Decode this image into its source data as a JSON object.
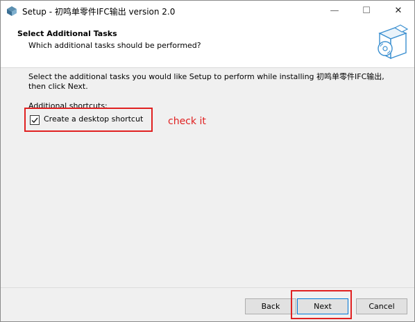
{
  "window": {
    "title": "Setup - 初鸣单零件IFC输出 version 2.0"
  },
  "titlebar": {
    "minimize": "—",
    "maximize": "☐",
    "close": "✕"
  },
  "header": {
    "title": "Select Additional Tasks",
    "subtitle": "Which additional tasks should be performed?"
  },
  "content": {
    "description": "Select the additional tasks you would like Setup to perform while installing 初鸣单零件IFC输出, then click Next.",
    "group_label": "Additional shortcuts:",
    "checkbox": {
      "label": "Create a desktop shortcut",
      "checked": true
    }
  },
  "annotation": {
    "text": "check it",
    "color": "#e02020"
  },
  "buttons": {
    "back": "Back",
    "next": "Next",
    "cancel": "Cancel"
  }
}
